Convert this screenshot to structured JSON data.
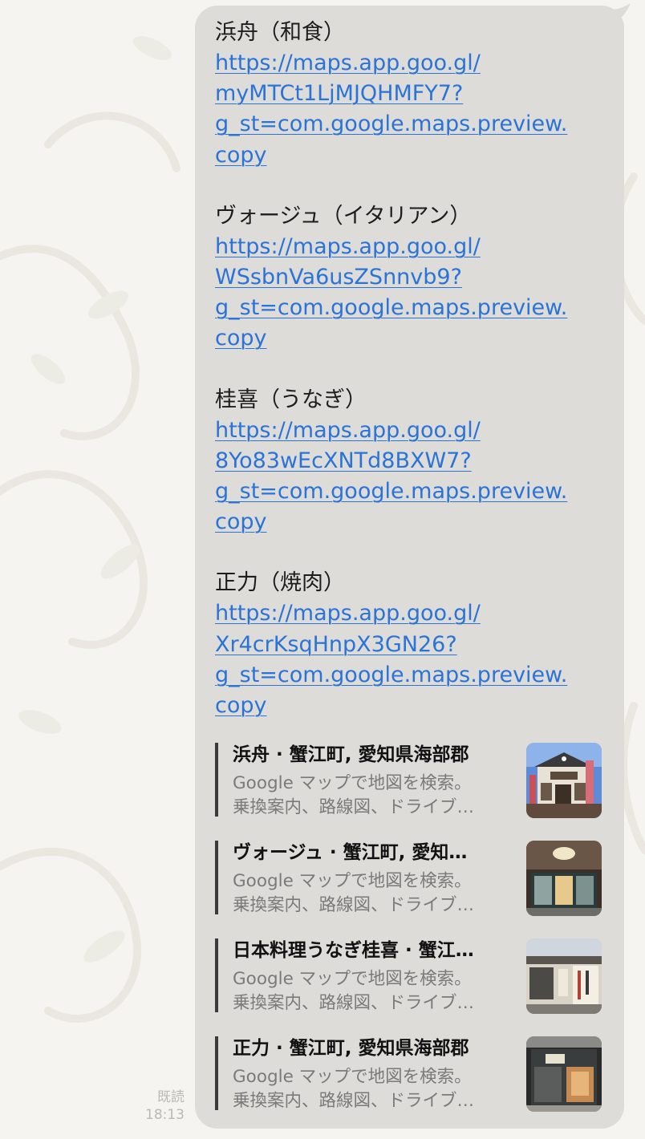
{
  "messages": [
    {
      "name": "浜舟（和食）",
      "link_lines": [
        "https://maps.app.goo.gl/",
        "myMTCt1LjMJQHMFY7?",
        "g_st=com.google.maps.preview.",
        "copy"
      ]
    },
    {
      "name": "ヴォージュ（イタリアン）",
      "link_lines": [
        "https://maps.app.goo.gl/",
        "WSsbnVa6usZSnnvb9?",
        "g_st=com.google.maps.preview.",
        "copy"
      ]
    },
    {
      "name": "桂喜（うなぎ）",
      "link_lines": [
        "https://maps.app.goo.gl/",
        "8Yo83wEcXNTd8BXW7?",
        "g_st=com.google.maps.preview.",
        "copy"
      ]
    },
    {
      "name": "正力（焼肉）",
      "link_lines": [
        "https://maps.app.goo.gl/",
        "Xr4crKsqHnpX3GN26?",
        "g_st=com.google.maps.preview.",
        "copy"
      ]
    }
  ],
  "previews": [
    {
      "title": "浜舟 · 蟹江町, 愛知県海部郡",
      "desc1": "Google マップで地図を検索。",
      "desc2": "乗換案内、路線図、ドライブ…"
    },
    {
      "title": "ヴォージュ · 蟹江町, 愛知…",
      "desc1": "Google マップで地図を検索。",
      "desc2": "乗換案内、路線図、ドライブ…"
    },
    {
      "title": "日本料理うなぎ桂喜 · 蟹江…",
      "desc1": "Google マップで地図を検索。",
      "desc2": "乗換案内、路線図、ドライブ…"
    },
    {
      "title": "正力 · 蟹江町, 愛知県海部郡",
      "desc1": "Google マップで地図を検索。",
      "desc2": "乗換案内、路線図、ドライブ…"
    }
  ],
  "status": {
    "read_label": "既読",
    "time": "18:13"
  },
  "colors": {
    "bubble": "#dddcd8",
    "link": "#2a73d8",
    "background": "#f5f4f0"
  }
}
